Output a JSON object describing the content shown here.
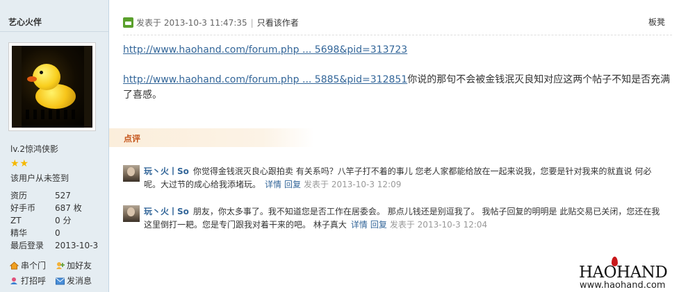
{
  "sidebar": {
    "author_name": "艺心火伴",
    "rank": "lv.2惊鸿侠影",
    "stars": "★★",
    "signin": "该用户从未签到",
    "stats": [
      {
        "label": "资历",
        "value": "527"
      },
      {
        "label": "好手币",
        "value": "687 枚"
      },
      {
        "label": "ZT",
        "value": "0 分"
      },
      {
        "label": "精华",
        "value": "0"
      },
      {
        "label": "最后登录",
        "value": "2013-10-3"
      }
    ],
    "actions": [
      {
        "label": "串个门",
        "icon": "house-icon"
      },
      {
        "label": "加好友",
        "icon": "add-friend-icon"
      },
      {
        "label": "打招呼",
        "icon": "greet-icon"
      },
      {
        "label": "发消息",
        "icon": "message-icon"
      }
    ]
  },
  "post": {
    "posted_label": "发表于 2013-10-3 11:47:35",
    "only_author": "只看该作者",
    "floor": "板凳",
    "link1": "http://www.haohand.com/forum.php ... 5698&pid=313723",
    "link2": "http://www.haohand.com/forum.php ... 5885&pid=312851",
    "body_text": "你说的那句不会被金钱泯灭良知对应这两个帖子不知是否充满了喜感。"
  },
  "comments_section": {
    "title": "点评",
    "items": [
      {
        "user": "玩丶火丨So",
        "text": "你觉得金钱泯灭良心跟拍卖 有关系吗？八竿子打不着的事儿 您老人家都能给放在一起来说我，您要是针对我来的就直说 何必呢。大过节的成心给我添堵玩。",
        "detail": "详情",
        "reply": "回复",
        "time": "发表于 2013-10-3 12:09"
      },
      {
        "user": "玩丶火丨So",
        "text": "朋友，你太多事了。我不知道您是否工作在居委会。 那点儿钱还是别逗我了。 我帖子回复的明明是 此贴交易已关闭，您还在我这里倒打一耙。您是专门跟我对着干来的吧。 林子真大",
        "detail": "详情",
        "reply": "回复",
        "time": "发表于 2013-10-3 12:04"
      }
    ]
  },
  "watermark": {
    "logo": "HAOHAND",
    "url": "www.haohand.com"
  },
  "colors": {
    "link": "#336699",
    "sidebar_bg": "#e5edf2",
    "comment_title": "#c5551b",
    "time": "#999999"
  }
}
